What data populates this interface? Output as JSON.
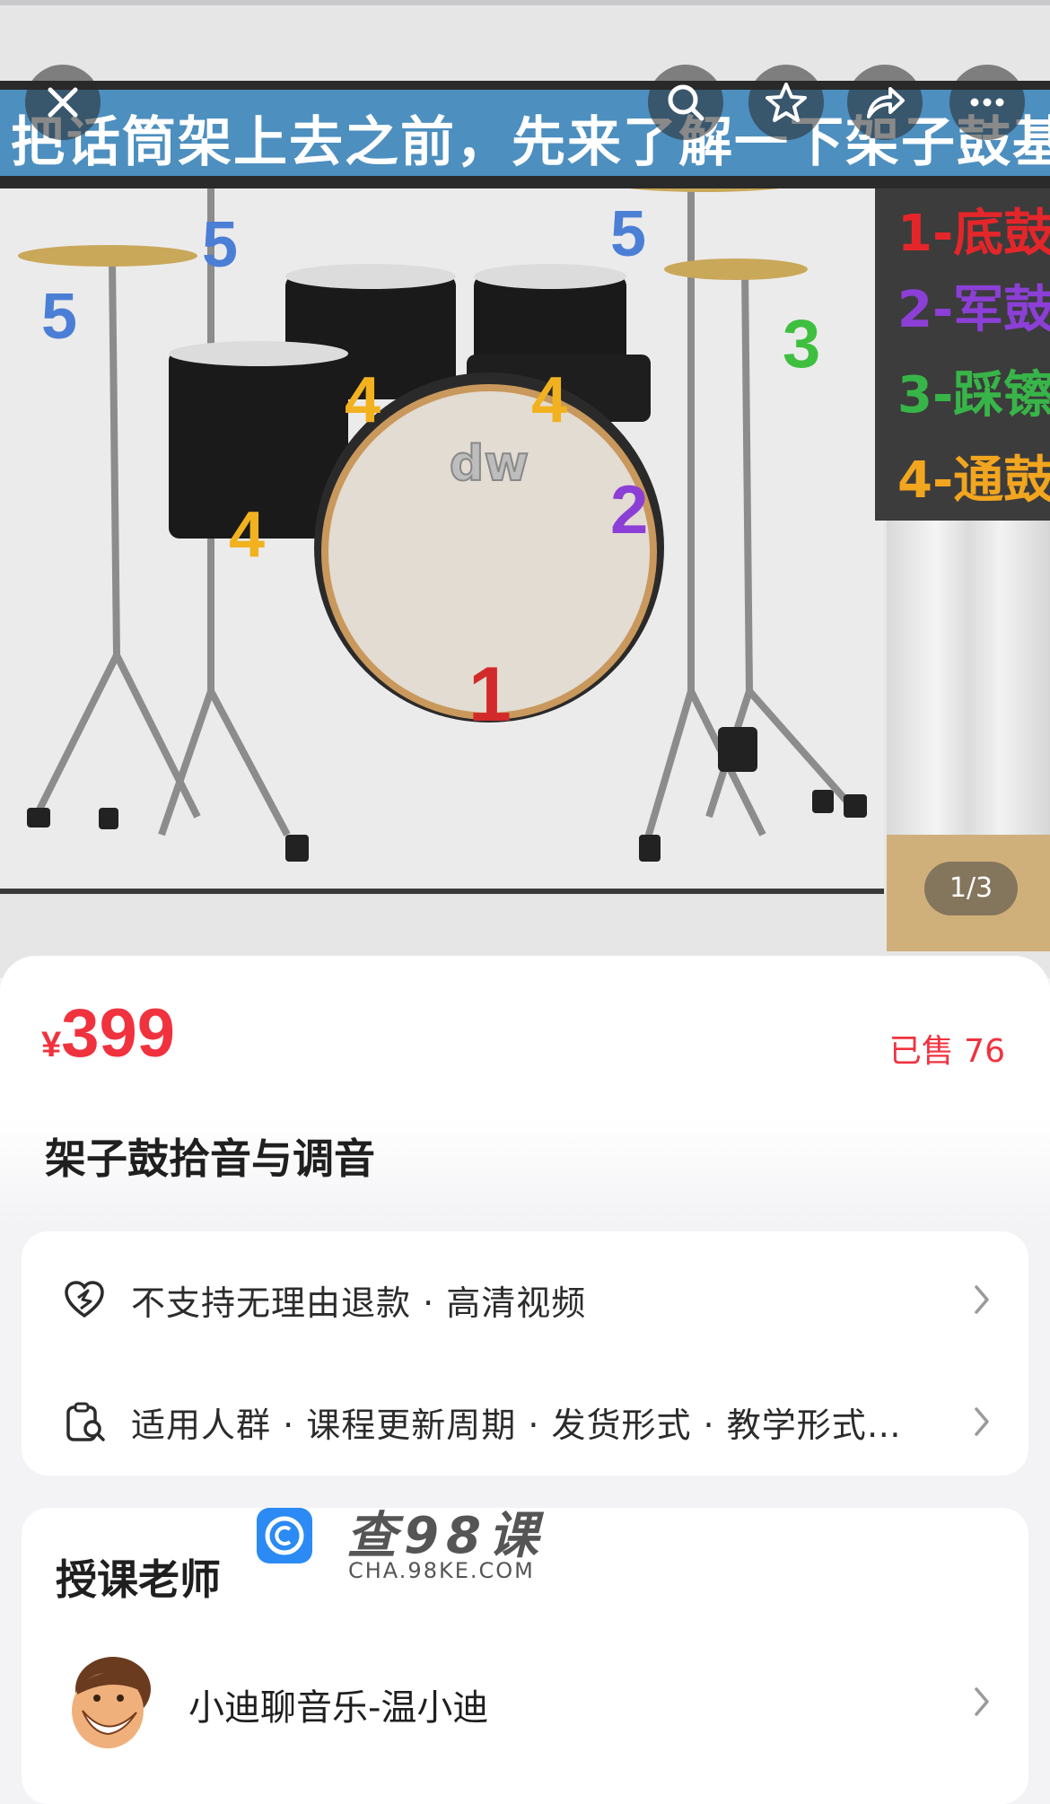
{
  "gallery": {
    "banner_text": "把话筒架上去之前，先来了解一下架子鼓基",
    "legend": [
      "1-底鼓",
      "2-军鼓",
      "3-踩镲",
      "4-通鼓"
    ],
    "drum_numbers": [
      "5",
      "5",
      "5",
      "4",
      "4",
      "4",
      "3",
      "2",
      "1"
    ],
    "brand": "dw",
    "counter": "1/3"
  },
  "toolbar": {
    "close_icon": "close-icon",
    "search_icon": "search-icon",
    "favorite_icon": "star-icon",
    "share_icon": "share-icon",
    "more_icon": "more-icon"
  },
  "product": {
    "currency": "¥",
    "price": "399",
    "sold": "已售 76",
    "title": "架子鼓拾音与调音"
  },
  "info_rows": [
    {
      "text": "不支持无理由退款 · 高清视频",
      "icon": "refund-shield-icon"
    },
    {
      "text": "适用人群 · 课程更新周期 · 发货形式 · 教学形式…",
      "icon": "clipboard-search-icon"
    }
  ],
  "teacher": {
    "heading": "授课老师",
    "name": "小迪聊音乐-温小迪"
  },
  "watermark": {
    "title": "查98课",
    "url": "CHA.98KE.COM"
  },
  "colors": {
    "price_red": "#f0323e",
    "banner_blue": "#4d8fbf"
  }
}
